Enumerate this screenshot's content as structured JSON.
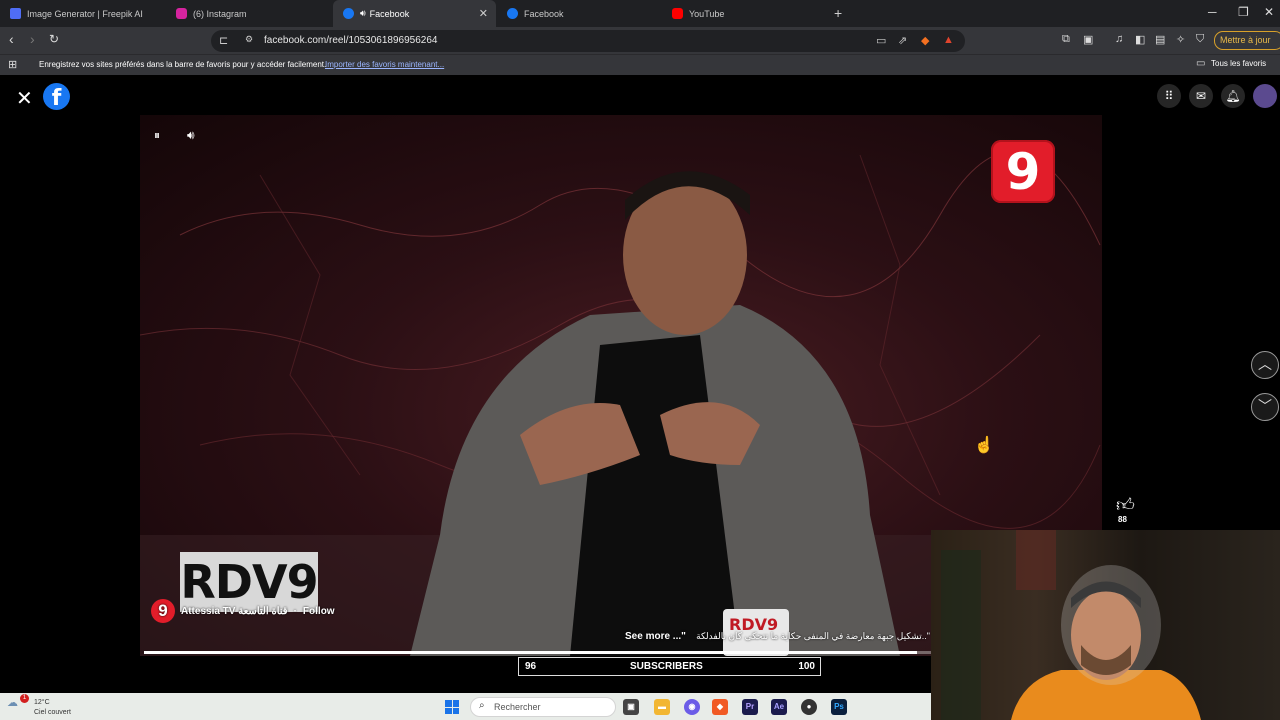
{
  "browser": {
    "tabs": [
      {
        "title": "Image Generator | Freepik AI",
        "fav_color": "#4f6df5"
      },
      {
        "title": "(6) Instagram",
        "fav_color": "#d6249f"
      },
      {
        "title": "Facebook",
        "fav_color": "#1877f2",
        "active": true
      },
      {
        "title": "Facebook",
        "fav_color": "#1877f2"
      },
      {
        "title": "YouTube",
        "fav_color": "#ff0000"
      }
    ],
    "url": "facebook.com/reel/1053061896956264",
    "update_label": "Mettre à jour",
    "bookmarks_prompt": "Enregistrez vos sites préférés dans la barre de favoris pour y accéder facilement.",
    "bookmarks_link": "Importer des favoris maintenant...",
    "all_bookmarks": "Tous les favoris"
  },
  "reel": {
    "channel_logo": "9",
    "show_logo": "RDV9",
    "page_name": "Attessia TV قناة التاسعة",
    "follow_label": "Follow",
    "caption": "تشكيل جبهة معارضة في المنفى حكاية ما تتحكى كان بالفدلكة..\"",
    "see_more": "See more ...\"",
    "like_count": "88",
    "mug_text": "RDV9",
    "progress": 0.81
  },
  "overlay": {
    "left_value": "96",
    "label": "SUBSCRIBERS",
    "right_value": "100"
  },
  "taskbar": {
    "temperature": "12°C",
    "weather": "Ciel couvert",
    "notification_count": "1",
    "search_placeholder": "Rechercher"
  }
}
